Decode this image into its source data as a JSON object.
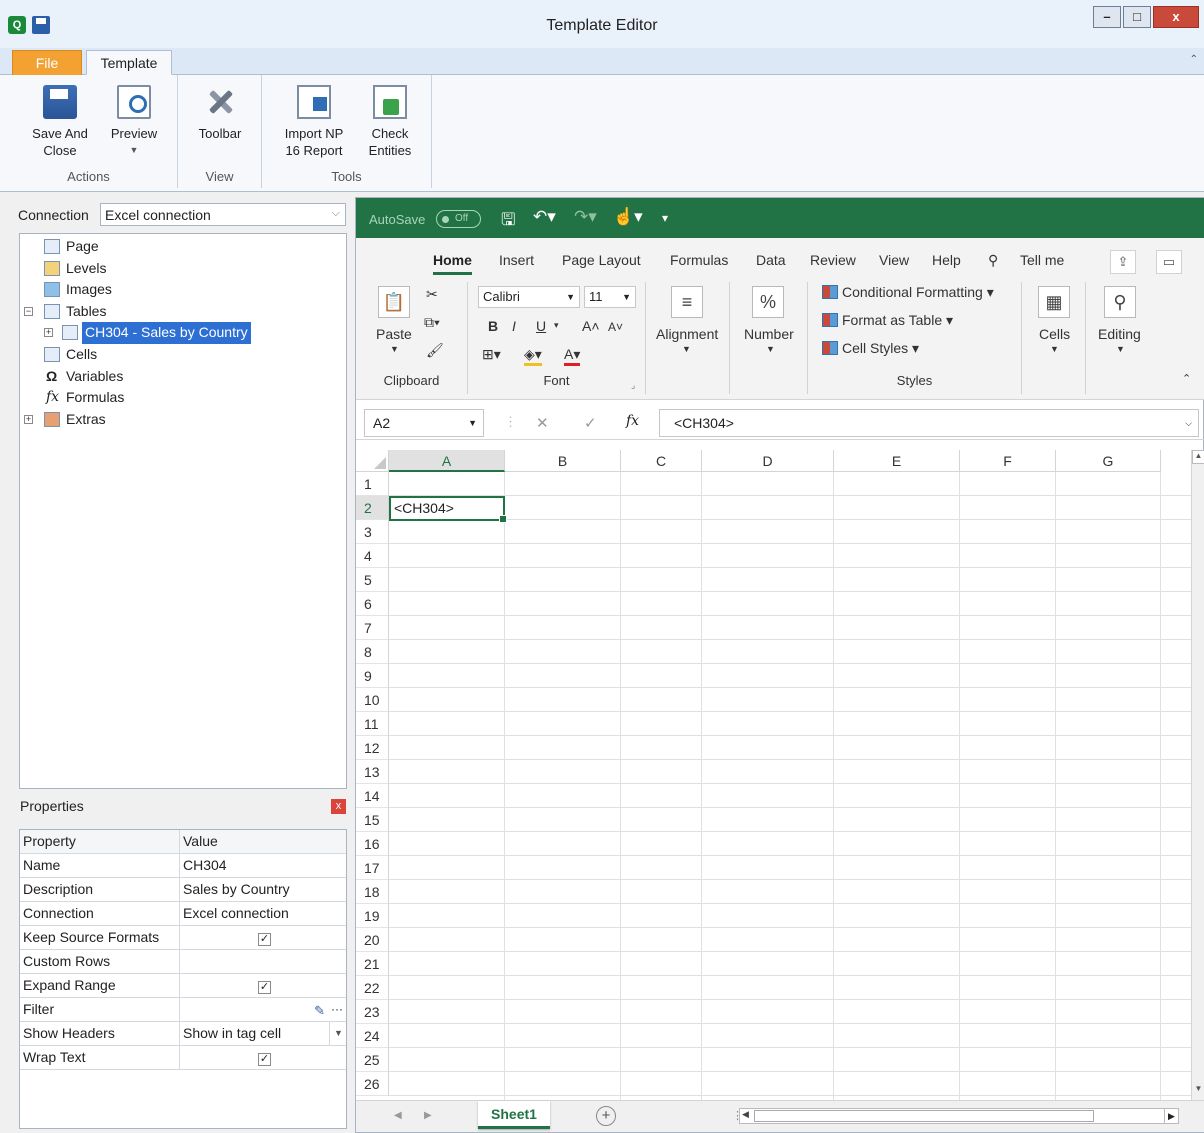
{
  "window": {
    "title": "Template Editor",
    "minimize": "–",
    "maximize": "□",
    "close": "x"
  },
  "ribbon_tabs": {
    "file": "File",
    "template": "Template",
    "collapse": "⌃"
  },
  "ribbon": {
    "save_and_close": "Save And\nClose",
    "preview": "Preview",
    "toolbar": "Toolbar",
    "import_report": "Import NP\n16 Report",
    "check_entities": "Check\nEntities",
    "group_actions": "Actions",
    "group_view": "View",
    "group_tools": "Tools"
  },
  "connection": {
    "label": "Connection",
    "value": "Excel connection"
  },
  "tree": {
    "items": [
      {
        "label": "Page"
      },
      {
        "label": "Levels"
      },
      {
        "label": "Images"
      },
      {
        "label": "Tables"
      },
      {
        "label": "CH304 - Sales by Country"
      },
      {
        "label": "Cells"
      },
      {
        "label": "Variables"
      },
      {
        "label": "Formulas"
      },
      {
        "label": "Extras"
      }
    ]
  },
  "properties": {
    "title": "Properties",
    "close": "x",
    "col_property": "Property",
    "col_value": "Value",
    "rows": [
      {
        "name": "Name",
        "value": "CH304"
      },
      {
        "name": "Description",
        "value": "Sales by Country"
      },
      {
        "name": "Connection",
        "value": "Excel connection"
      },
      {
        "name": "Keep Source Formats",
        "checked": "✓"
      },
      {
        "name": "Custom Rows",
        "value": ""
      },
      {
        "name": "Expand Range",
        "checked": "✓"
      },
      {
        "name": "Filter",
        "value": ""
      },
      {
        "name": "Show Headers",
        "value": "Show in tag cell"
      },
      {
        "name": "Wrap Text",
        "checked": "✓"
      }
    ],
    "filter_more": "···"
  },
  "excel": {
    "autosave_label": "AutoSave",
    "autosave_state": "Off",
    "tabs": {
      "home": "Home",
      "insert": "Insert",
      "page_layout": "Page Layout",
      "formulas": "Formulas",
      "data": "Data",
      "review": "Review",
      "view": "View",
      "help": "Help",
      "tell_me": "Tell me"
    },
    "clipboard": {
      "paste": "Paste",
      "label": "Clipboard"
    },
    "font": {
      "name": "Calibri",
      "size": "11",
      "label": "Font",
      "bold": "B",
      "italic": "I",
      "underline": "U"
    },
    "alignment": {
      "label": "Alignment"
    },
    "number": {
      "label": "Number",
      "symbol": "%"
    },
    "styles": {
      "conditional": "Conditional Formatting",
      "format_table": "Format as Table",
      "cell_styles": "Cell Styles",
      "label": "Styles"
    },
    "cells": {
      "label": "Cells"
    },
    "editing": {
      "label": "Editing"
    },
    "formula_bar": {
      "name_box": "A2",
      "fx": "fx",
      "content": "<CH304>"
    },
    "columns": [
      "A",
      "B",
      "C",
      "D",
      "E",
      "F",
      "G"
    ],
    "rows": [
      "1",
      "2",
      "3",
      "4",
      "5",
      "6",
      "7",
      "8",
      "9",
      "10",
      "11",
      "12",
      "13",
      "14",
      "15",
      "16",
      "17",
      "18",
      "19",
      "20",
      "21",
      "22",
      "23",
      "24",
      "25",
      "26"
    ],
    "active_cell_value": "<CH304>",
    "sheet_tab": "Sheet1",
    "add_sheet": "+"
  }
}
